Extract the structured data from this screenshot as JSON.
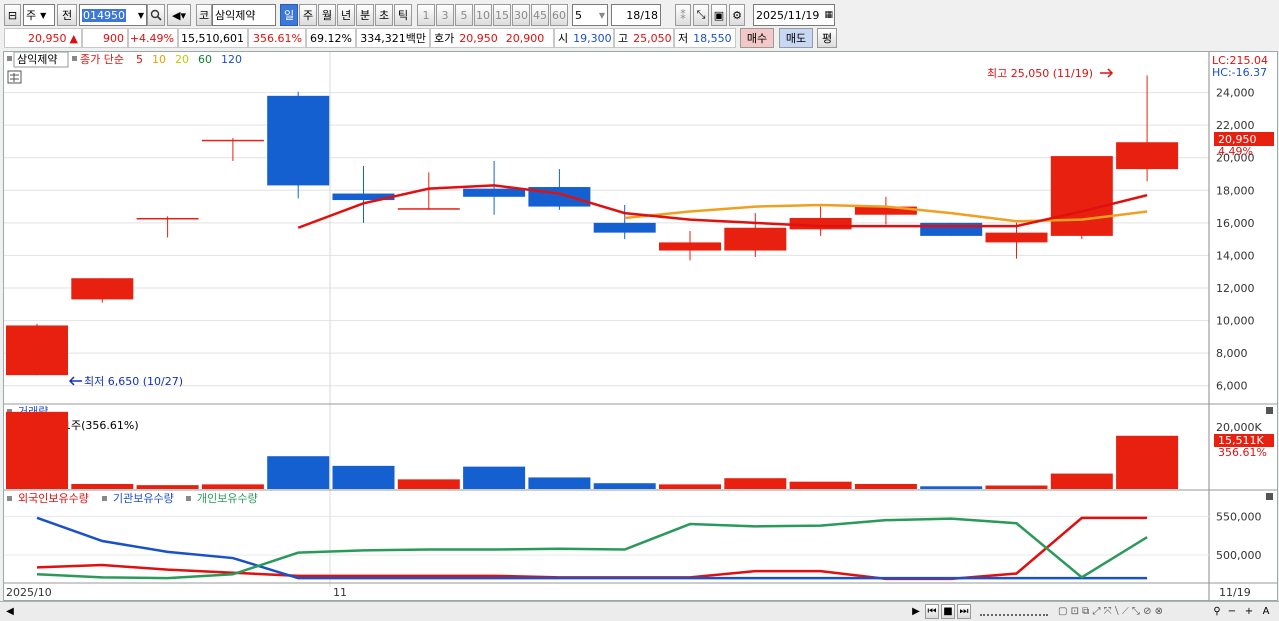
{
  "toolbar": {
    "period_select": "주",
    "prev_label": "전",
    "code": "014950",
    "stock_name_prefix": "코",
    "stock_name": "삼익제약",
    "period_tabs": [
      "일",
      "주",
      "월",
      "년",
      "분",
      "초",
      "틱"
    ],
    "period_selected": "일",
    "intervals": [
      "1",
      "3",
      "5",
      "10",
      "15",
      "30",
      "45",
      "60"
    ],
    "interval_value": "5",
    "count": "18/18",
    "date": "2025/11/19"
  },
  "quote": {
    "price": "20,950",
    "direction": "▲",
    "change": "900",
    "change_pct": "+4.49%",
    "volume": "15,510,601",
    "vol_ratio": "356.61%",
    "turnover": "69.12%",
    "amount": "334,321백만",
    "hoga_label": "호가",
    "ask": "20,950",
    "bid": "20,900",
    "open_label": "시",
    "open": "19,300",
    "high_label": "고",
    "high": "25,050",
    "low_label": "저",
    "low": "18,550",
    "buy_label": "매수",
    "sell_label": "매도",
    "eval_label": "평"
  },
  "chart_data": {
    "type": "candlestick",
    "name": "삼익제약",
    "legend": {
      "price_label": "종가 단순",
      "ma_periods": [
        "5",
        "10",
        "20",
        "60",
        "120"
      ],
      "ma_colors": [
        "#e01010",
        "#e8a000",
        "#c8c800",
        "#108030",
        "#1a50c8"
      ]
    },
    "x_ticks": [
      "2025/10",
      "11",
      "11/19"
    ],
    "candles": [
      {
        "o": 6650,
        "h": 9800,
        "l": 6650,
        "c": 9700,
        "up": true
      },
      {
        "o": 11300,
        "h": 12600,
        "l": 11100,
        "c": 12600,
        "up": true
      },
      {
        "o": 16300,
        "h": 16400,
        "l": 15100,
        "c": 16300,
        "up": true
      },
      {
        "o": 21100,
        "h": 21200,
        "l": 19800,
        "c": 21100,
        "up": true
      },
      {
        "o": 23800,
        "h": 24050,
        "l": 17500,
        "c": 18300,
        "up": false
      },
      {
        "o": 17800,
        "h": 19500,
        "l": 16000,
        "c": 17400,
        "up": false
      },
      {
        "o": 16900,
        "h": 19100,
        "l": 16800,
        "c": 16900,
        "up": true
      },
      {
        "o": 18100,
        "h": 19800,
        "l": 16500,
        "c": 17600,
        "up": false
      },
      {
        "o": 18200,
        "h": 19300,
        "l": 16800,
        "c": 17000,
        "up": false
      },
      {
        "o": 16000,
        "h": 17100,
        "l": 15000,
        "c": 15400,
        "up": false
      },
      {
        "o": 14300,
        "h": 15500,
        "l": 13700,
        "c": 14800,
        "up": true
      },
      {
        "o": 14300,
        "h": 16600,
        "l": 13900,
        "c": 15700,
        "up": true
      },
      {
        "o": 15600,
        "h": 17000,
        "l": 15200,
        "c": 16300,
        "up": true
      },
      {
        "o": 16500,
        "h": 17600,
        "l": 15900,
        "c": 17000,
        "up": true
      },
      {
        "o": 16000,
        "h": 16000,
        "l": 15200,
        "c": 15200,
        "up": false
      },
      {
        "o": 14800,
        "h": 16000,
        "l": 13800,
        "c": 15400,
        "up": true
      },
      {
        "o": 15200,
        "h": 20100,
        "l": 15000,
        "c": 20100,
        "up": true
      },
      {
        "o": 19300,
        "h": 25050,
        "l": 18550,
        "c": 20950,
        "up": true
      }
    ],
    "ma5": [
      null,
      null,
      null,
      null,
      15700,
      17200,
      18100,
      18300,
      17800,
      16600,
      16200,
      16000,
      15800,
      15800,
      15800,
      15800,
      16700,
      17700
    ],
    "ma10": [
      null,
      null,
      null,
      null,
      null,
      null,
      null,
      null,
      null,
      16300,
      16700,
      17000,
      17100,
      17000,
      16600,
      16100,
      16200,
      16700
    ],
    "y_ticks": [
      "24,000",
      "22,000",
      "20,000",
      "18,000",
      "16,000",
      "14,000",
      "12,000",
      "10,000",
      "8,000",
      "6,000"
    ],
    "y_range": [
      5000,
      26000
    ],
    "annotations": {
      "high": "최고 25,050 (11/19)",
      "low": "최저 6,650 (10/27)",
      "lc": "LC:215.04",
      "hc": "HC:-16.37",
      "price_tag": "20,950",
      "pct_tag": "4.49%"
    },
    "volume": {
      "title": "거래량",
      "caption": "15,510,601주(356.61%)",
      "y_tick": "20,000K",
      "tag": "15,511K",
      "tag_pct": "356.61%",
      "values": [
        20000,
        1300,
        1000,
        1200,
        8500,
        6000,
        2500,
        5800,
        3000,
        1500,
        1200,
        2800,
        1900,
        1300,
        700,
        900,
        4000,
        13800
      ],
      "ups": [
        true,
        true,
        true,
        true,
        false,
        false,
        true,
        false,
        false,
        false,
        true,
        true,
        true,
        true,
        false,
        true,
        true,
        true
      ]
    },
    "holdings": {
      "series": [
        {
          "name": "외국인보유수량",
          "color": "#e01010",
          "values": [
            484,
            487,
            481,
            477,
            473,
            473,
            473,
            473,
            471,
            471,
            471,
            479,
            479,
            469,
            469,
            476,
            548,
            548
          ]
        },
        {
          "name": "기관보유수량",
          "color": "#1a50c8",
          "values": [
            548,
            518,
            504,
            496,
            470,
            470,
            470,
            470,
            470,
            470,
            470,
            470,
            470,
            470,
            470,
            470,
            470,
            470
          ]
        },
        {
          "name": "개인보유수량",
          "color": "#2a9a5a",
          "values": [
            475,
            471,
            470,
            475,
            503,
            506,
            507,
            507,
            508,
            507,
            540,
            537,
            538,
            545,
            547,
            541,
            471,
            523
          ]
        }
      ],
      "y_ticks": [
        "550,000",
        "500,000"
      ]
    }
  }
}
